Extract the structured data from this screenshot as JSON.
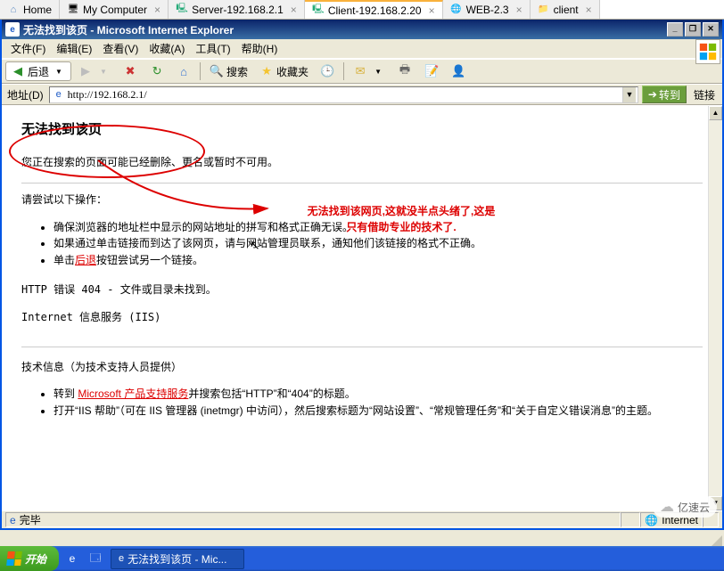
{
  "vm_tabs": {
    "items": [
      {
        "label": "Home"
      },
      {
        "label": "My Computer"
      },
      {
        "label": "Server-192.168.2.1"
      },
      {
        "label": "Client-192.168.2.20"
      },
      {
        "label": "WEB-2.3"
      },
      {
        "label": "client"
      }
    ],
    "active_index": 3
  },
  "window_title": "无法找到该页 - Microsoft Internet Explorer",
  "menu": {
    "file": "文件(F)",
    "edit": "编辑(E)",
    "view": "查看(V)",
    "fav": "收藏(A)",
    "tools": "工具(T)",
    "help": "帮助(H)"
  },
  "toolbar": {
    "back_label": "后退",
    "search_label": "搜索",
    "fav_label": "收藏夹"
  },
  "address": {
    "label": "地址(D)",
    "url": "http://192.168.2.1/",
    "go": "转到",
    "links": "链接"
  },
  "page": {
    "h1": "无法找到该页",
    "p1": "您正在搜索的页面可能已经删除、更名或暂时不可用。",
    "p2": "请尝试以下操作：",
    "li1": "确保浏览器的地址栏中显示的网站地址的拼写和格式正确无误。",
    "li2": "如果通过单击链接而到达了该网页，请与网站管理员联系，通知他们该链接的格式不正确。",
    "li3_a": "单击",
    "li3_link": "后退",
    "li3_b": "按钮尝试另一个链接。",
    "err1": "HTTP 错误 404 - 文件或目录未找到。",
    "err2": "Internet 信息服务 (IIS)",
    "tech_hdr": "技术信息（为技术支持人员提供）",
    "tech_li1_a": "转到 ",
    "tech_li1_link": "Microsoft 产品支持服务",
    "tech_li1_b": "并搜索包括“HTTP”和“404”的标题。",
    "tech_li2": "打开“IIS 帮助”（可在 IIS 管理器 (inetmgr) 中访问），然后搜索标题为“网站设置”、“常规管理任务”和“关于自定义错误消息”的主题。"
  },
  "annotation": {
    "line1": "无法找到该网页,这就没半点头绪了,这是",
    "line2": "只有借助专业的技术了."
  },
  "status": {
    "done": "完毕",
    "zone": "Internet"
  },
  "taskbar": {
    "start": "开始",
    "task1": "无法找到该页 - Mic..."
  },
  "watermark": "亿速云"
}
